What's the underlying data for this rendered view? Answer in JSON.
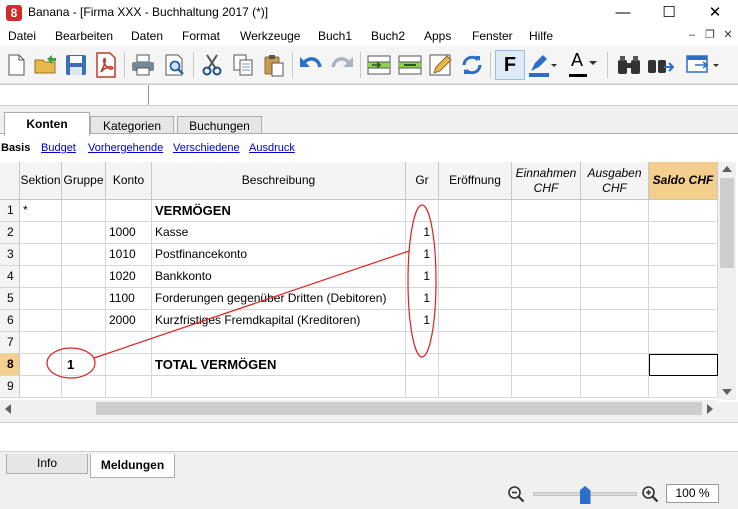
{
  "window": {
    "title": "Banana - [Firma XXX - Buchhaltung 2017 (*)]",
    "logo": "8",
    "minimize": "—",
    "maximize": "☐",
    "close": "✕"
  },
  "menu": [
    "Datei",
    "Bearbeiten",
    "Daten",
    "Format",
    "Werkzeuge",
    "Buch1",
    "Buch2",
    "Apps",
    "Fenster",
    "Hilfe"
  ],
  "toolbar": {
    "icons": [
      "new-file-icon",
      "open-folder-icon",
      "save-icon",
      "pdf-icon",
      "print-icon",
      "print-preview-icon",
      "cut-icon",
      "copy-icon",
      "paste-icon",
      "undo-icon",
      "redo-icon",
      "insert-row-icon",
      "delete-row-icon",
      "edit-pencil-icon",
      "recalculate-icon",
      "bold-icon",
      "highlight-icon",
      "font-color-icon",
      "find-icon",
      "find-next-icon",
      "window-switch-icon"
    ],
    "bold_label": "F",
    "font_color_label": "A",
    "accent_blue": "#2a6fc9",
    "font_color_bar": "#000000"
  },
  "tabs": [
    "Konten",
    "Kategorien",
    "Buchungen"
  ],
  "views": [
    "Basis",
    "Budget",
    "Vorhergehende",
    "Verschiedene",
    "Ausdruck"
  ],
  "table": {
    "headers": [
      "Sektion",
      "Gruppe",
      "Konto",
      "Beschreibung",
      "Gr",
      "Eröffnung",
      "Einnahmen CHF",
      "Ausgaben CHF",
      "Saldo CHF"
    ],
    "rows": [
      {
        "n": "1",
        "sektion": "*",
        "gruppe": "",
        "konto": "",
        "beschreibung": "VERMÖGEN",
        "gr": ""
      },
      {
        "n": "2",
        "sektion": "",
        "gruppe": "",
        "konto": "1000",
        "beschreibung": "Kasse",
        "gr": "1"
      },
      {
        "n": "3",
        "sektion": "",
        "gruppe": "",
        "konto": "1010",
        "beschreibung": "Postfinancekonto",
        "gr": "1"
      },
      {
        "n": "4",
        "sektion": "",
        "gruppe": "",
        "konto": "1020",
        "beschreibung": "Bankkonto",
        "gr": "1"
      },
      {
        "n": "5",
        "sektion": "",
        "gruppe": "",
        "konto": "1100",
        "beschreibung": "Forderungen gegenüber Dritten (Debitoren)",
        "gr": "1"
      },
      {
        "n": "6",
        "sektion": "",
        "gruppe": "",
        "konto": "2000",
        "beschreibung": "Kurzfristiges Fremdkapital (Kreditoren)",
        "gr": "1"
      },
      {
        "n": "7",
        "sektion": "",
        "gruppe": "",
        "konto": "",
        "beschreibung": "",
        "gr": ""
      },
      {
        "n": "8",
        "sektion": "",
        "gruppe": "1",
        "konto": "",
        "beschreibung": "TOTAL VERMÖGEN",
        "gr": ""
      },
      {
        "n": "9",
        "sektion": "",
        "gruppe": "",
        "konto": "",
        "beschreibung": "",
        "gr": ""
      }
    ]
  },
  "bottom_tabs": [
    "Info",
    "Meldungen"
  ],
  "zoom": {
    "value": "100 %",
    "level": 0.5
  },
  "colors": {
    "highlight": "#f3ce8c",
    "annotation": "#e02020",
    "link": "#0000d0"
  }
}
